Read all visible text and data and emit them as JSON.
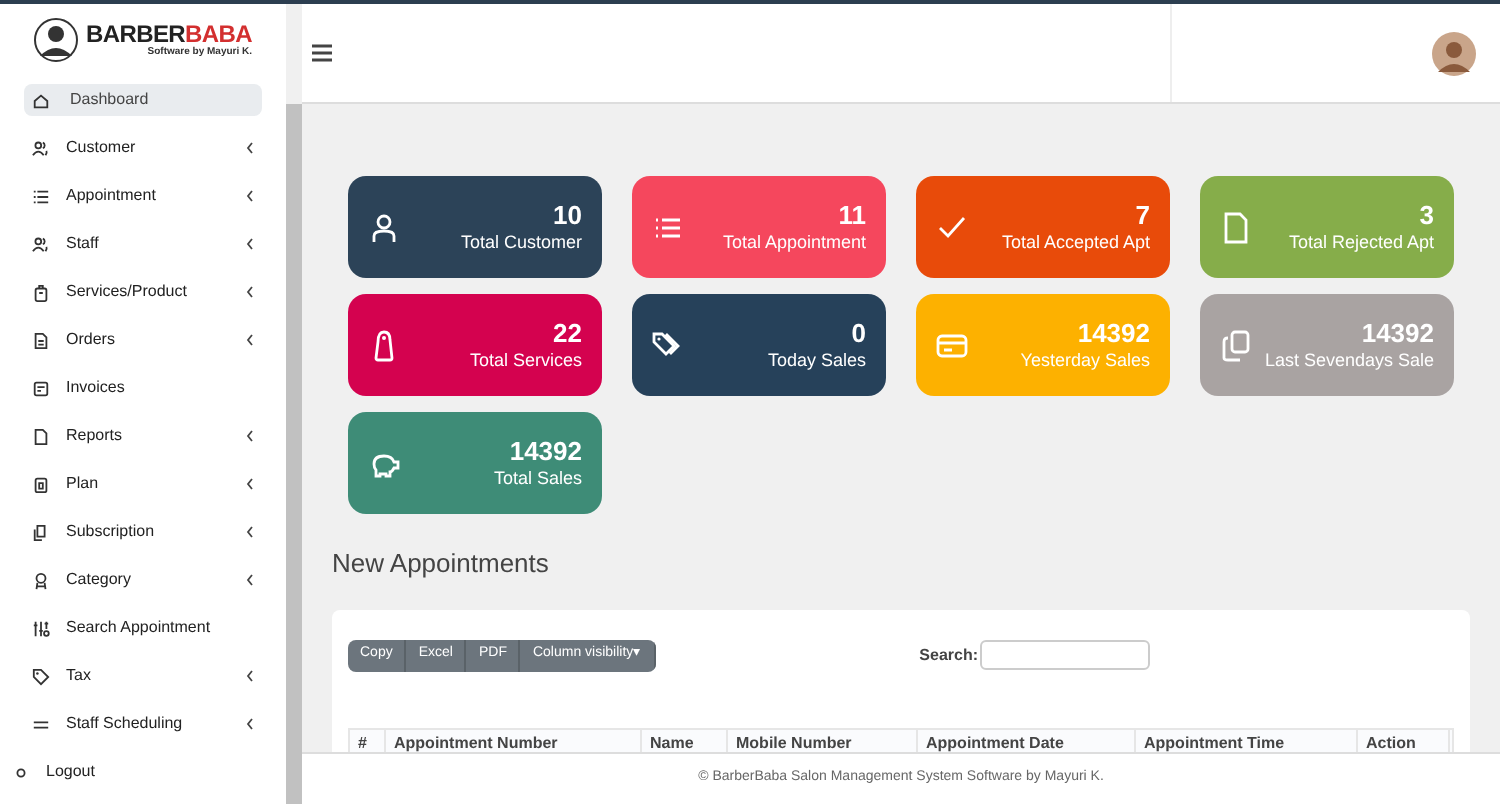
{
  "brand": {
    "name_part_1": "BARBER",
    "name_part_2": "BABA",
    "tagline": "Software by Mayuri K."
  },
  "sidebar": {
    "items": [
      {
        "label": "Dashboard",
        "selected": true,
        "kind": "link"
      },
      {
        "label": "Customer",
        "selected": false,
        "kind": "submenu"
      },
      {
        "label": "Appointment",
        "selected": false,
        "kind": "submenu"
      },
      {
        "label": "Staff",
        "selected": false,
        "kind": "submenu"
      },
      {
        "label": "Services/Product",
        "selected": false,
        "kind": "submenu"
      },
      {
        "label": "Orders",
        "selected": false,
        "kind": "submenu"
      },
      {
        "label": "Invoices",
        "selected": false,
        "kind": "link"
      },
      {
        "label": "Reports",
        "selected": false,
        "kind": "submenu"
      },
      {
        "label": "Plan",
        "selected": false,
        "kind": "submenu"
      },
      {
        "label": "Subscription",
        "selected": false,
        "kind": "submenu"
      },
      {
        "label": "Category",
        "selected": false,
        "kind": "submenu"
      },
      {
        "label": "Search Appointment",
        "selected": false,
        "kind": "link"
      },
      {
        "label": "Tax",
        "selected": false,
        "kind": "submenu"
      },
      {
        "label": "Staff Scheduling",
        "selected": false,
        "kind": "submenu"
      },
      {
        "label": "Logout",
        "selected": false,
        "kind": "logout"
      }
    ]
  },
  "cards": [
    {
      "value": "10",
      "label": "Total Customer",
      "color": "#2c4358"
    },
    {
      "value": "11",
      "label": "Total Appointment",
      "color": "#f5475d"
    },
    {
      "value": "7",
      "label": "Total Accepted Apt",
      "color": "#e84b0a"
    },
    {
      "value": "3",
      "label": "Total Rejected Apt",
      "color": "#86ad4a"
    },
    {
      "value": "22",
      "label": "Total Services",
      "color": "#d4024f"
    },
    {
      "value": "0",
      "label": "Today Sales",
      "color": "#26415a"
    },
    {
      "value": "14392",
      "label": "Yesterday Sales",
      "color": "#fdb100"
    },
    {
      "value": "14392",
      "label": "Last Sevendays Sale",
      "color": "#a9a3a2"
    },
    {
      "value": "14392",
      "label": "Total Sales",
      "color": "#3e8c77"
    }
  ],
  "section_title": "New Appointments",
  "table": {
    "buttons": [
      {
        "label": "Copy"
      },
      {
        "label": "Excel"
      },
      {
        "label": "PDF"
      },
      {
        "label": "Column visibility▾"
      }
    ],
    "search_label": "Search:",
    "columns": [
      "#",
      "Appointment Number",
      "Name",
      "Mobile Number",
      "Appointment Date",
      "Appointment Time",
      "Action"
    ]
  },
  "footer": "© BarberBaba Salon Management System Software by Mayuri K."
}
